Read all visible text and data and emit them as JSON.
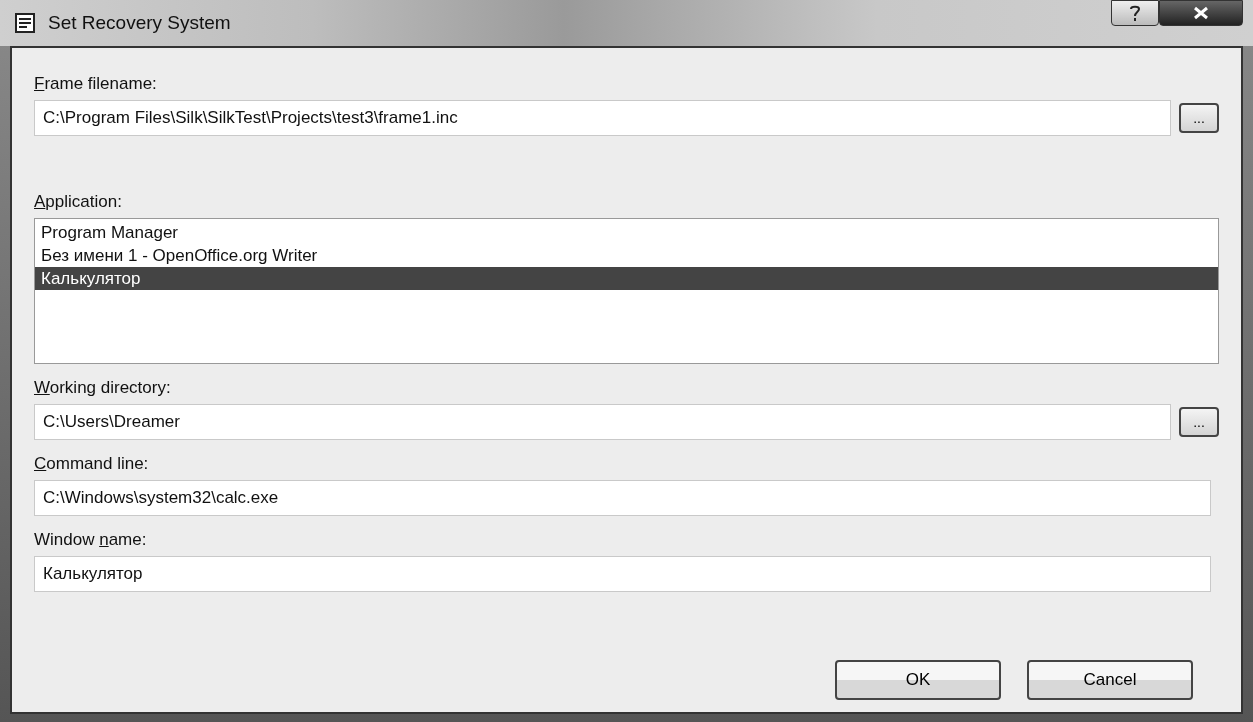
{
  "window": {
    "title": "Set Recovery System"
  },
  "fields": [
    {
      "kind": "text",
      "label": [
        {
          "text": "F",
          "access_key": true
        },
        {
          "text": "rame filename:",
          "access_key": false
        }
      ],
      "value": "C:\\Program Files\\Silk\\SilkTest\\Projects\\test3\\frame1.inc",
      "browse": "..."
    },
    {
      "kind": "list",
      "label": [
        {
          "text": "A",
          "access_key": true
        },
        {
          "text": "pplication:",
          "access_key": false
        }
      ],
      "items": [
        {
          "text": "Program Manager",
          "selected": false
        },
        {
          "text": "Без имени 1 - OpenOffice.org Writer",
          "selected": false
        },
        {
          "text": "Калькулятор",
          "selected": true
        }
      ]
    },
    {
      "kind": "text",
      "label": [
        {
          "text": "W",
          "access_key": true
        },
        {
          "text": "orking directory:",
          "access_key": false
        }
      ],
      "value": "C:\\Users\\Dreamer",
      "browse": "..."
    },
    {
      "kind": "text",
      "label": [
        {
          "text": "C",
          "access_key": true
        },
        {
          "text": "ommand line:",
          "access_key": false
        }
      ],
      "value": "C:\\Windows\\system32\\calc.exe"
    },
    {
      "kind": "text",
      "label": [
        {
          "text": "Window ",
          "access_key": false
        },
        {
          "text": "n",
          "access_key": true
        },
        {
          "text": "ame:",
          "access_key": false
        }
      ],
      "value": "Калькулятор"
    }
  ],
  "buttons": [
    "OK",
    "Cancel"
  ]
}
